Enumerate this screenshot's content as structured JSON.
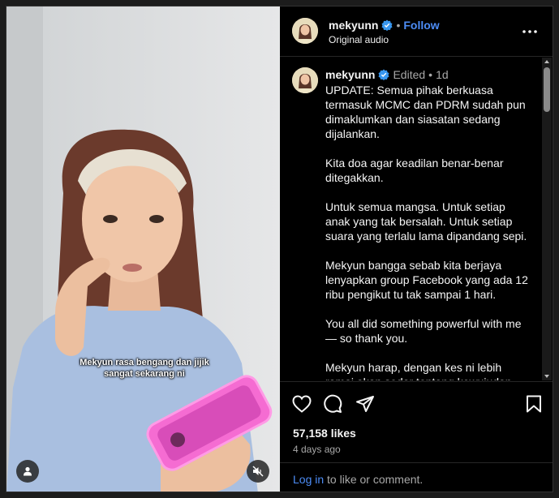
{
  "post": {
    "username": "mekyunn",
    "verified": true,
    "follow_label": "Follow",
    "audio": "Original audio",
    "separator": "•"
  },
  "video": {
    "caption_line1": "Mekyun rasa bengang dan jijik",
    "caption_line2": "sangat sekarang ni"
  },
  "comment": {
    "username": "mekyunn",
    "edited": "Edited",
    "separator": "•",
    "time": "1d",
    "paragraphs": [
      "UPDATE: Semua pihak berkuasa termasuk MCMC dan PDRM sudah pun dimaklumkan dan siasatan sedang dijalankan.",
      "Kita doa agar keadilan benar-benar ditegakkan.",
      "Untuk semua mangsa. Untuk setiap anak yang tak bersalah. Untuk setiap suara yang terlalu lama dipandang sepi.",
      "Mekyun bangga sebab kita berjaya lenyapkan group Facebook yang ada 12 ribu pengikut tu tak sampai 1 hari.",
      "You all did something powerful with me — so thank you.",
      "Mekyun harap, dengan kes ni lebih ramai akan sedar tentang kewujudan"
    ]
  },
  "stats": {
    "likes": "57,158 likes",
    "date": "4 days ago"
  },
  "login": {
    "link": "Log in",
    "rest": " to like or comment."
  },
  "colors": {
    "accent": "#4d8df6",
    "background": "#000000",
    "muted": "#a8a8a8",
    "verified": "#3897f0"
  },
  "icons": {
    "verified": "verified-badge-icon",
    "more": "more-options-icon",
    "like": "heart-icon",
    "comment": "comment-icon",
    "share": "share-icon",
    "save": "bookmark-icon",
    "user": "user-icon",
    "mute": "muted-speaker-icon"
  }
}
